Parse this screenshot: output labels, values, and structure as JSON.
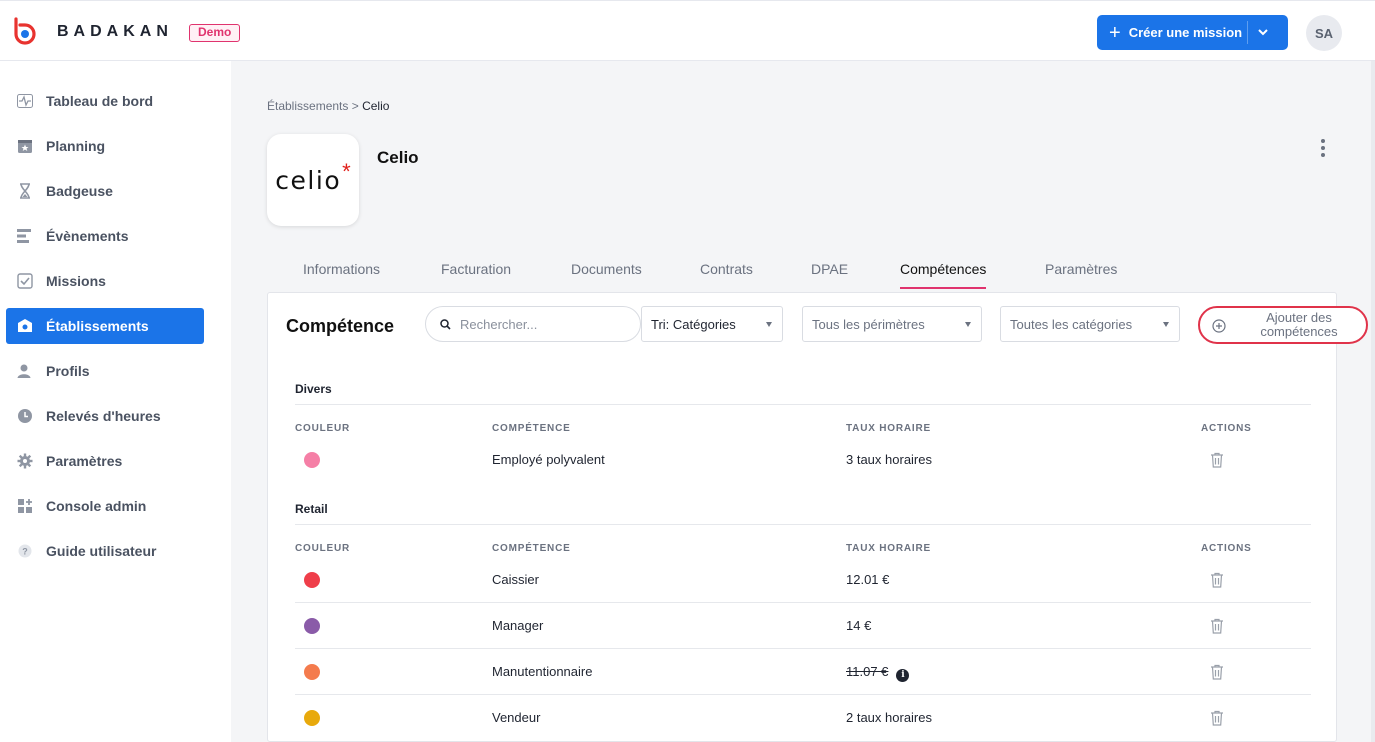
{
  "header": {
    "brand": "BADAKAN",
    "badge": "Demo",
    "create_button": "Créer une mission",
    "avatar_initials": "SA",
    "accent_color": "#1b74e8"
  },
  "sidebar": {
    "items": [
      {
        "label": "Tableau de bord",
        "icon": "pulse-icon"
      },
      {
        "label": "Planning",
        "icon": "calendar-star-icon"
      },
      {
        "label": "Badgeuse",
        "icon": "hourglass-icon"
      },
      {
        "label": "Évènements",
        "icon": "events-list-icon"
      },
      {
        "label": "Missions",
        "icon": "checklist-icon"
      },
      {
        "label": "Établissements",
        "icon": "building-icon",
        "active": true
      },
      {
        "label": "Profils",
        "icon": "user-icon"
      },
      {
        "label": "Relevés d'heures",
        "icon": "clock-icon"
      },
      {
        "label": "Paramètres",
        "icon": "gear-icon"
      },
      {
        "label": "Console admin",
        "icon": "grid-plus-icon"
      },
      {
        "label": "Guide utilisateur",
        "icon": "help-icon"
      }
    ]
  },
  "breadcrumb": {
    "parent": "Établissements",
    "separator": ">",
    "current": "Celio"
  },
  "establishment": {
    "name": "Celio",
    "logo_text": "celio",
    "logo_mark": "*"
  },
  "tabs": [
    {
      "label": "Informations"
    },
    {
      "label": "Facturation"
    },
    {
      "label": "Documents"
    },
    {
      "label": "Contrats"
    },
    {
      "label": "DPAE"
    },
    {
      "label": "Compétences",
      "active": true
    },
    {
      "label": "Paramètres"
    }
  ],
  "panel": {
    "title": "Compétence",
    "search_placeholder": "Rechercher...",
    "sort_select": "Tri: Catégories",
    "perimeter_select": "Tous les périmètres",
    "category_select": "Toutes les catégories",
    "add_button": "Ajouter des compétences",
    "columns": {
      "color": "COULEUR",
      "skill": "COMPÉTENCE",
      "rate": "TAUX HORAIRE",
      "actions": "ACTIONS"
    },
    "groups": [
      {
        "name": "Divers",
        "rows": [
          {
            "color": "#f57fa6",
            "skill": "Employé polyvalent",
            "rate": "3 taux horaires"
          }
        ]
      },
      {
        "name": "Retail",
        "rows": [
          {
            "color": "#ef3e4a",
            "skill": "Caissier",
            "rate": "12.01 €"
          },
          {
            "color": "#8a5ba8",
            "skill": "Manager",
            "rate": "14 €"
          },
          {
            "color": "#f47b4d",
            "skill": "Manutentionnaire",
            "rate": "11.07 €",
            "struck": true
          },
          {
            "color": "#e8a90c",
            "skill": "Vendeur",
            "rate": "2 taux horaires"
          }
        ]
      }
    ]
  }
}
